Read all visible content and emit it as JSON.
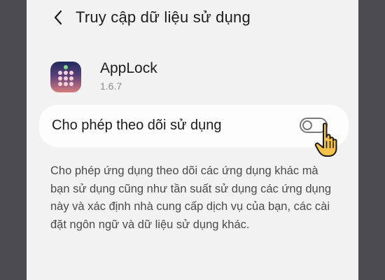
{
  "header": {
    "back_icon": "chevron-left-icon",
    "title": "Truy cập dữ liệu sử dụng"
  },
  "app": {
    "name": "AppLock",
    "version": "1.6.7",
    "icon": "applock-icon"
  },
  "setting": {
    "label": "Cho phép theo dõi sử dụng",
    "toggle_on": false
  },
  "description": "Cho phép ứng dụng theo dõi các ứng dụng khác mà bạn sử dụng cũng như tần suất sử dụng các ứng dụng này và xác định nhà cung cấp dịch vụ của bạn, các cài đặt ngôn ngữ và dữ liệu sử dụng khác.",
  "colors": {
    "background": "#f2f2f2",
    "card": "#fdfdfd",
    "frame": "#4a4a50",
    "cursor_fill": "#f5c24a"
  }
}
